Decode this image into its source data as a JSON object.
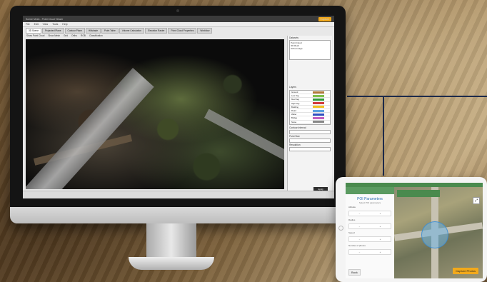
{
  "desktop_app": {
    "title": "Scene Mesh - Point Cloud Viewer",
    "capture_button": "Capture",
    "menu": [
      "File",
      "Edit",
      "View",
      "Tools",
      "Help"
    ],
    "tabs": [
      "3D Scene",
      "Projected Plane",
      "Contour Plane",
      "Hillshade",
      "Point Table",
      "Volume Calculation",
      "Elevation Raster",
      "Point Cloud Properties",
      "Workflow"
    ],
    "view_options": [
      "Show Point Cloud",
      "Show Mesh",
      "Grid",
      "Ortho",
      "RGB",
      "Classification"
    ],
    "panel": {
      "layers_label": "Datasets",
      "layers": [
        "Point Cloud",
        "3D Mesh",
        "Ortho Image"
      ],
      "legend_label": "Layers",
      "legend": [
        {
          "name": "Ground",
          "color": "#b07a3a"
        },
        {
          "name": "Low Veg",
          "color": "#7fc04a"
        },
        {
          "name": "Med Veg",
          "color": "#2f9b3a"
        },
        {
          "name": "High Veg",
          "color": "#d23a3a"
        },
        {
          "name": "Building",
          "color": "#f0c020"
        },
        {
          "name": "Road",
          "color": "#5aa0e0"
        },
        {
          "name": "Water",
          "color": "#3050c0"
        },
        {
          "name": "Bridge",
          "color": "#c060c0"
        },
        {
          "name": "Noise",
          "color": "#888888"
        }
      ],
      "fields": [
        "Contour Interval",
        "Point Size",
        "Resolution"
      ],
      "apply_button": "Apply"
    }
  },
  "tablet_app": {
    "panel_title": "POI Parameters",
    "panel_subtitle": "Select POI parameters",
    "labels": [
      "Altitude",
      "Radius",
      "Speed",
      "Number of photos"
    ],
    "back_button": "Back",
    "capture_button": "Capture Photos"
  }
}
